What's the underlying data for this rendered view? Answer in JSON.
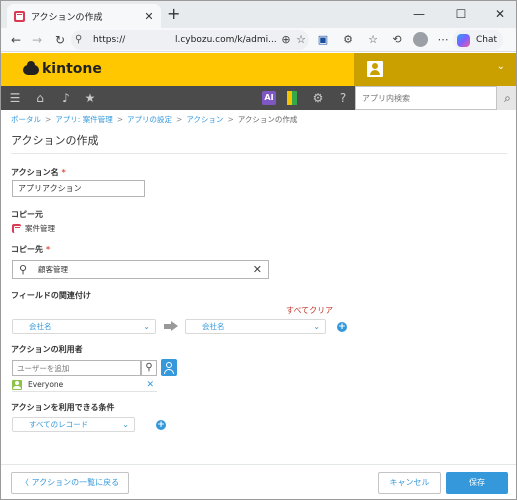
{
  "browser": {
    "tab_title": "アクションの作成",
    "url_prefix": "https://",
    "url_host": "l.cybozu.com/k/admi...",
    "chat_label": "Chat"
  },
  "kintone": {
    "logo": "kintone",
    "ai_badge": "AI",
    "app_search_placeholder": "アプリ内検索"
  },
  "breadcrumb": {
    "portal": "ポータル",
    "app": "アプリ: 案件管理",
    "settings": "アプリの設定",
    "action": "アクション",
    "current": "アクションの作成",
    "separator": ">"
  },
  "page": {
    "title": "アクションの作成"
  },
  "form": {
    "action_name_label": "アクション名",
    "action_name_value": "アプリアクション",
    "copy_from_label": "コピー元",
    "copy_from_app": "案件管理",
    "copy_to_label": "コピー先",
    "copy_to_value": "顧客管理",
    "field_mapping_label": "フィールドの関連付け",
    "clear_all": "すべてクリア",
    "mapping_source": "会社名",
    "mapping_target": "会社名",
    "users_label": "アクションの利用者",
    "user_add_placeholder": "ユーザーを追加",
    "user_entity": "Everyone",
    "conditions_label": "アクションを利用できる条件",
    "condition_value": "すべてのレコード",
    "required_mark": "*"
  },
  "footer": {
    "back_label": "アクションの一覧に戻る",
    "cancel_label": "キャンセル",
    "save_label": "保存"
  },
  "colors": {
    "header_yellow": "#ffc700",
    "toolbar": "#4b4b4b",
    "link_blue": "#3498db",
    "clear_red": "#c0392b",
    "required_red": "#e74c3c"
  }
}
